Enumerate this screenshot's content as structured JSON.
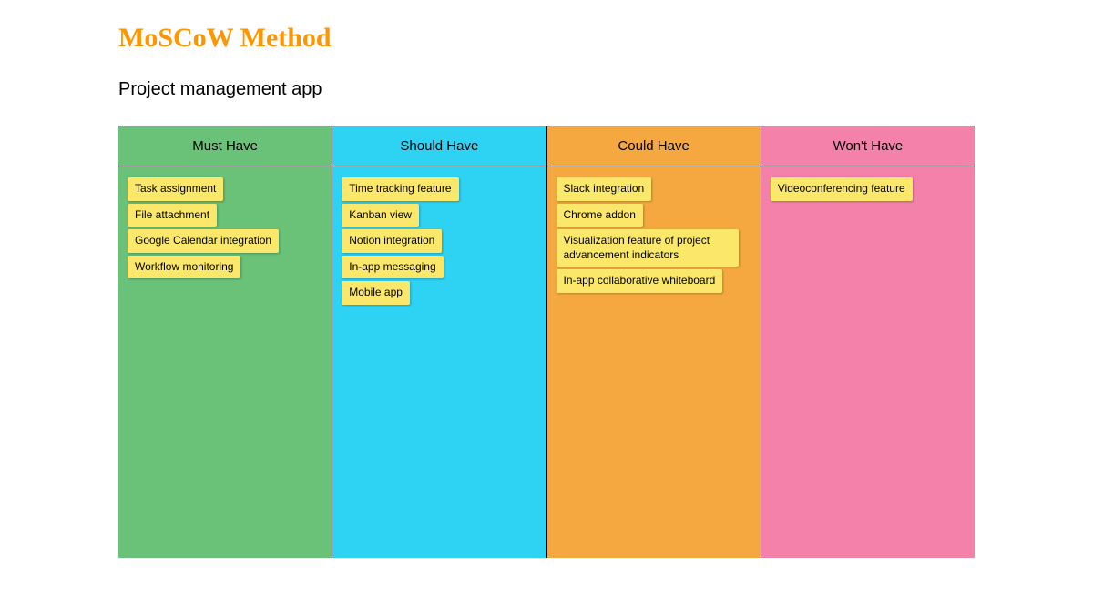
{
  "title": "MoSCoW Method",
  "subtitle": "Project management app",
  "colors": {
    "title": "#ff9500",
    "card": "#fbe86a",
    "must": "#6ac178",
    "should": "#2ed2f2",
    "could": "#f5a83f",
    "wont": "#f381a9"
  },
  "columns": [
    {
      "key": "must",
      "header": "Must Have",
      "cards": [
        "Task assignment",
        "File attachment",
        "Google Calendar integration",
        "Workflow monitoring"
      ]
    },
    {
      "key": "should",
      "header": "Should Have",
      "cards": [
        "Time tracking feature",
        "Kanban view",
        "Notion integration",
        "In-app messaging",
        "Mobile app"
      ]
    },
    {
      "key": "could",
      "header": "Could Have",
      "cards": [
        "Slack integration",
        "Chrome addon",
        "Visualization feature of project advancement indicators",
        "In-app collaborative whiteboard"
      ]
    },
    {
      "key": "wont",
      "header": "Won't Have",
      "cards": [
        "Videoconferencing feature"
      ]
    }
  ]
}
